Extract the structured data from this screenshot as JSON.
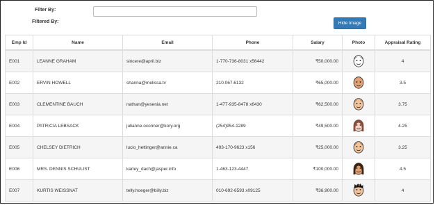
{
  "filter": {
    "label": "Filter By:",
    "filtered_label": "Filtered By:",
    "value": "",
    "placeholder": ""
  },
  "hide_button": {
    "label": "Hide Image"
  },
  "columns": [
    "Emp Id",
    "Name",
    "Email",
    "Phone",
    "Salary",
    "Photo",
    "Appraisal Rating"
  ],
  "rows": [
    {
      "id": "E001",
      "name": "LEANNE GRAHAM",
      "email": "sincere@april.biz",
      "phone": "1-770-736-8031 x56442",
      "salary": "₹50,000.00",
      "rating": "4",
      "photo": "avatar-male-cartoon-icon"
    },
    {
      "id": "E002",
      "name": "ERVIN HOWELL",
      "email": "shanna@melissa.tv",
      "phone": "210.067.6132",
      "salary": "₹65,000.00",
      "rating": "3.5",
      "photo": "avatar-bald-man-icon"
    },
    {
      "id": "E003",
      "name": "CLEMENTINE BAUCH",
      "email": "nathan@yesenia.net",
      "phone": "1-477-935-8478 x6430",
      "salary": "₹62,500.00",
      "rating": "3.75",
      "photo": "avatar-man-icon"
    },
    {
      "id": "E004",
      "name": "PATRICIA LEBSACK",
      "email": "julianne.oconner@kory.org",
      "phone": "(254)954-1289",
      "salary": "₹49,500.00",
      "rating": "4.25",
      "photo": "avatar-woman-icon"
    },
    {
      "id": "E005",
      "name": "CHELSEY DIETRICH",
      "email": "lucio_hettinger@annie.ca",
      "phone": "493-170-9623 x156",
      "salary": "₹25,000.00",
      "rating": "3.25",
      "photo": "avatar-man-dark-hair-icon"
    },
    {
      "id": "E006",
      "name": "MRS. DENNIS SCHULIST",
      "email": "karley_dach@jasper.info",
      "phone": "1-463-123-4447",
      "salary": "₹100,000.00",
      "rating": "4.5",
      "photo": "avatar-woman-dark-hair-icon"
    },
    {
      "id": "E007",
      "name": "KURTIS WEISSNAT",
      "email": "telly.hoeger@billy.biz",
      "phone": "010-692-6593 x09125",
      "salary": "₹36,900.00",
      "rating": "4",
      "photo": "avatar-spiky-hair-man-icon"
    }
  ]
}
